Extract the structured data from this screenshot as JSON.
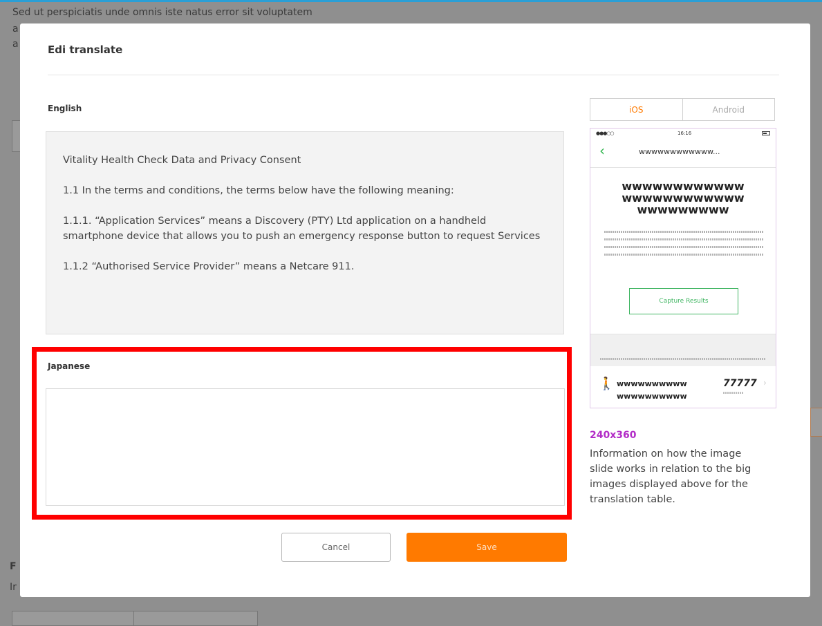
{
  "background": {
    "line1": "Sed ut perspiciatis unde omnis iste natus error sit voluptatem",
    "line2": "a",
    "line3": "a",
    "edge1": "F",
    "edge2": "Ir"
  },
  "modal": {
    "title": "Edi translate",
    "source_label": "English",
    "source_paragraphs": [
      "Vitality Health Check Data and Privacy Consent",
      "1.1 In the terms and conditions, the terms below have the following meaning:",
      "1.1.1. “Application Services” means a Discovery (PTY) Ltd application on a handheld smartphone device that allows you to push an emergency response button to request Services",
      "1.1.2 “Authorised Service Provider” means a Netcare 911."
    ],
    "target_label": "Japanese",
    "target_value": "",
    "cancel_label": "Cancel",
    "save_label": "Save"
  },
  "preview": {
    "tabs": [
      "iOS",
      "Android"
    ],
    "active_tab": "iOS",
    "phone": {
      "time": "16:16",
      "nav_title": "wwwwwwwwwwww...",
      "headline": [
        "wwwwwwwwwwww",
        "wwwwwwwwwwww",
        "wwwwwwwww"
      ],
      "capture_label": "Capture Results",
      "row_line1": "wwwwwwwwww",
      "row_line2": "wwwwwwwwww",
      "row_number": "77777"
    },
    "size": "240x360",
    "info": "Information on how the image slide works in relation to the big images displayed above for the translation table."
  },
  "colors": {
    "accent": "#ff7a00",
    "highlight": "#ff0000",
    "size_label": "#b22cc7",
    "phone_green": "#2cb34a"
  }
}
